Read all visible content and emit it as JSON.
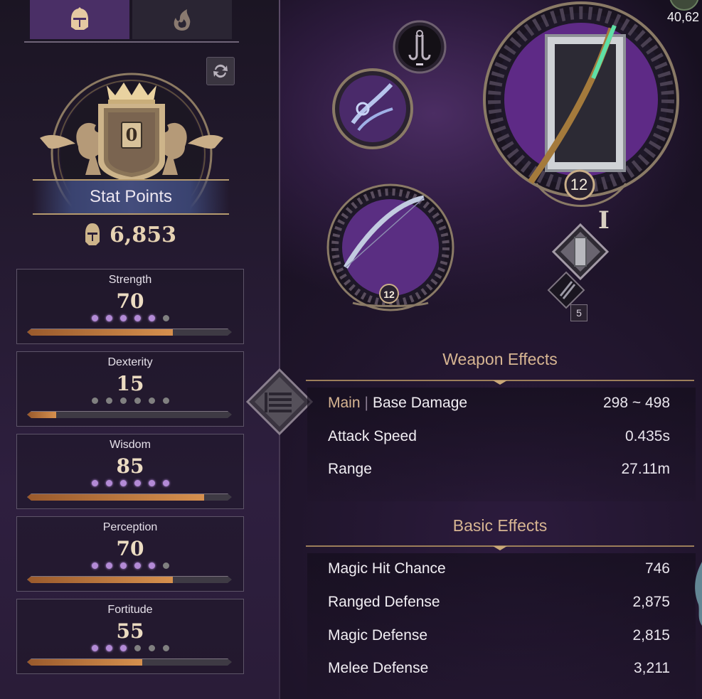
{
  "tabs": [
    {
      "id": "character",
      "icon": "knight-helmet-icon",
      "active": true
    },
    {
      "id": "skills",
      "icon": "flame-leaf-icon",
      "active": false
    }
  ],
  "stat_points": {
    "label": "Stat Points",
    "available": "0",
    "combat_power": "6,853"
  },
  "stats": [
    {
      "name": "Strength",
      "value": "70",
      "dots_filled": 5,
      "dots_total": 6,
      "progress": 0.71
    },
    {
      "name": "Dexterity",
      "value": "15",
      "dots_filled": 0,
      "dots_total": 6,
      "progress": 0.14
    },
    {
      "name": "Wisdom",
      "value": "85",
      "dots_filled": 6,
      "dots_total": 6,
      "progress": 0.86
    },
    {
      "name": "Perception",
      "value": "70",
      "dots_filled": 5,
      "dots_total": 6,
      "progress": 0.71
    },
    {
      "name": "Fortitude",
      "value": "55",
      "dots_filled": 3,
      "dots_total": 6,
      "progress": 0.56
    }
  ],
  "equipment": {
    "main_weapon_level": "12",
    "main_weapon_tier": "I",
    "bow_level": "12",
    "slot_count": "5"
  },
  "top_right_value": "40,62",
  "weapon_effects": {
    "title": "Weapon Effects",
    "main_tag": "Main",
    "rows": [
      {
        "label": "Base Damage",
        "value": "298 ~ 498"
      },
      {
        "label": "Attack Speed",
        "value": "0.435s"
      },
      {
        "label": "Range",
        "value": "27.11m"
      }
    ]
  },
  "basic_effects": {
    "title": "Basic Effects",
    "rows": [
      {
        "label": "Magic Hit Chance",
        "value": "746"
      },
      {
        "label": "Ranged Defense",
        "value": "2,875"
      },
      {
        "label": "Magic Defense",
        "value": "2,815"
      },
      {
        "label": "Melee Defense",
        "value": "3,211"
      }
    ]
  },
  "colors": {
    "accent_gold": "#d7b592",
    "purple_active": "#4a2f66",
    "bar_fill": "#d6904e",
    "dot_on": "#b38ad6"
  }
}
